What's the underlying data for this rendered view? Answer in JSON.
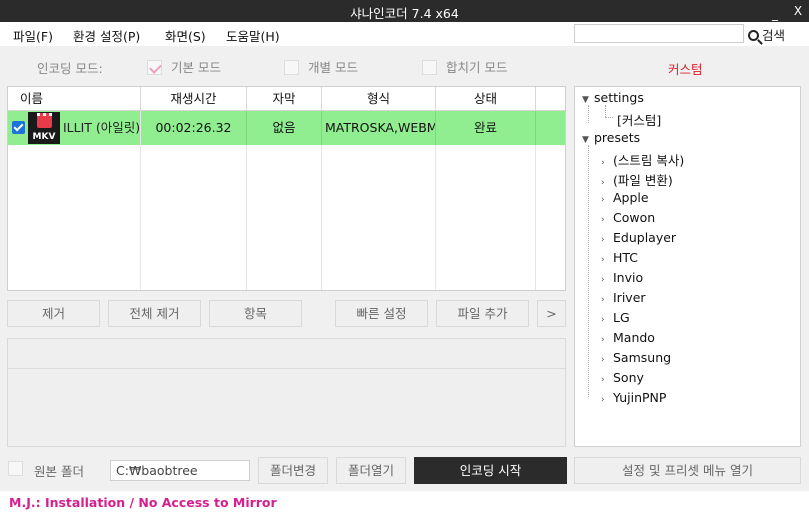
{
  "window": {
    "title": "샤나인코더  7.4  x64",
    "minimize_glyph": "_",
    "close_glyph": "X"
  },
  "menu": {
    "items": [
      "파일(F)",
      "환경 설정(P)",
      "화면(S)",
      "도움말(H)"
    ],
    "search_value": "",
    "search_label": "검색"
  },
  "modes": {
    "label": "인코딩 모드:",
    "options": [
      {
        "label": "기본 모드",
        "checked": true
      },
      {
        "label": "개별 모드",
        "checked": false
      },
      {
        "label": "합치기 모드",
        "checked": false
      }
    ],
    "custom_label": "커스텀"
  },
  "file_list": {
    "headers": [
      "이름",
      "재생시간",
      "자막",
      "형식",
      "상태"
    ],
    "rows": [
      {
        "checked": true,
        "icon": "mkv-file-icon",
        "icon_ext": "MKV",
        "name": "ILLIT (아일릿)",
        "duration": "00:02:26.32",
        "subtitle": "없음",
        "format": "MATROSKA,WEBM",
        "status": "완료"
      }
    ],
    "row_color": "#90ee90"
  },
  "list_buttons": {
    "remove": "제거",
    "remove_all": "전체 제거",
    "items": "항목",
    "quick_settings": "빠른 설정",
    "add_file": "파일 추가",
    "more": ">"
  },
  "tree": {
    "settings_label": "settings",
    "settings_children": [
      "[커스텀]"
    ],
    "presets_label": "presets",
    "presets_children": [
      "(스트림 복사)",
      "(파일 변환)",
      "Apple",
      "Cowon",
      "Eduplayer",
      "HTC",
      "Invio",
      "Iriver",
      "LG",
      "Mando",
      "Samsung",
      "Sony",
      "YujinPNP"
    ]
  },
  "bottom": {
    "source_folder_label": "원본 폴더",
    "source_folder_checked": false,
    "output_path": "C:₩baobtree",
    "change_folder": "폴더변경",
    "open_folder": "폴더열기",
    "start_encoding": "인코딩 시작",
    "open_settings_menu": "설정 및 프리셋 메뉴 열기"
  },
  "status": {
    "text": "M.J.: Installation / No Access to Mirror",
    "color": "#d61f8f"
  },
  "colors": {
    "titlebar": "#2b2b2b",
    "accent_red": "#e0202a",
    "row_green": "#90ee90",
    "checkbox_blue": "#1d74d8"
  }
}
